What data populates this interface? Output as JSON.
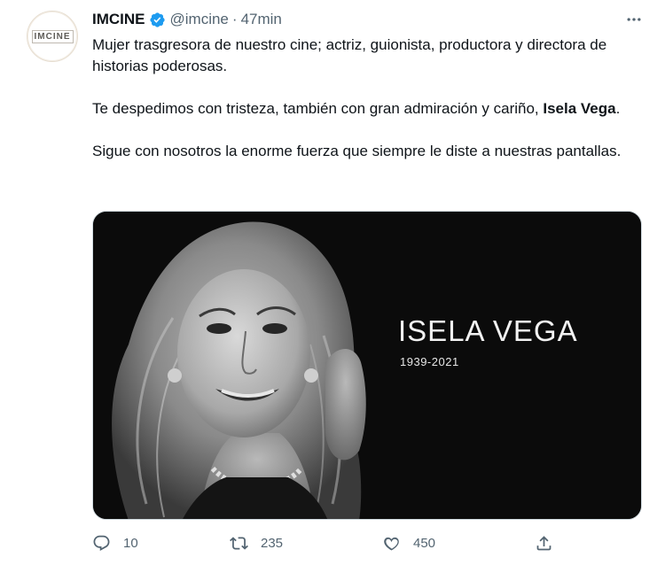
{
  "tweet": {
    "author": {
      "name": "IMCINE",
      "handle": "@imcine",
      "avatar_text": "IMCINE",
      "verified": true
    },
    "separator": "·",
    "time": "47min",
    "paragraphs": [
      {
        "text": "Mujer trasgresora de nuestro cine; actriz, guionista, productora y directora de historias poderosas."
      },
      {
        "text_before": "Te despedimos con tristeza, también con gran admiración y cariño, ",
        "bold": "Isela Vega",
        "text_after": "."
      },
      {
        "text": "Sigue con nosotros la enorme fuerza que siempre le diste a nuestras pantallas."
      }
    ],
    "media": {
      "title": "ISELA VEGA",
      "years": "1939-2021"
    },
    "actions": {
      "reply_count": "10",
      "retweet_count": "235",
      "like_count": "450"
    }
  },
  "icons": {
    "verified": "verified-badge-icon",
    "more": "more-icon",
    "reply": "reply-icon",
    "retweet": "retweet-icon",
    "like": "heart-icon",
    "share": "share-icon"
  },
  "colors": {
    "verified_blue": "#1d9bf0",
    "secondary_text": "#536471",
    "primary_text": "#0f1419",
    "media_background": "#0b0b0b"
  }
}
